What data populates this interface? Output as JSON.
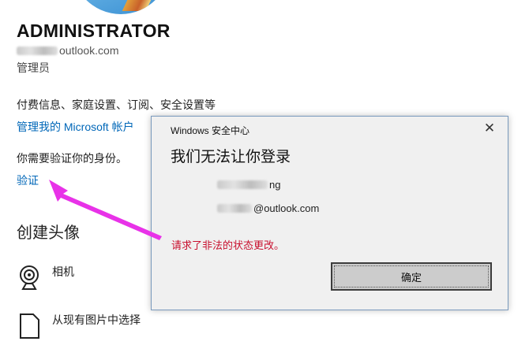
{
  "account": {
    "name": "ADMINISTRATOR",
    "email_suffix": "outlook.com",
    "role": "管理员"
  },
  "billing_info": "付费信息、家庭设置、订阅、安全设置等",
  "manage_link": "管理我的 Microsoft 帐户",
  "verify_prompt": "你需要验证你的身份。",
  "verify_link": "验证",
  "create_avatar": {
    "heading": "创建头像",
    "options": [
      {
        "label": "相机",
        "icon": "camera-icon"
      },
      {
        "label": "从现有图片中选择",
        "icon": "file-icon"
      }
    ]
  },
  "dialog": {
    "title": "Windows 安全中心",
    "close": "✕",
    "heading": "我们无法让你登录",
    "username_suffix": "ng",
    "email_suffix": "@outlook.com",
    "error": "请求了非法的状态更改。",
    "ok_button": "确定"
  },
  "colors": {
    "link": "#0067b8",
    "error": "#c8102e",
    "arrow": "#e832e8"
  }
}
